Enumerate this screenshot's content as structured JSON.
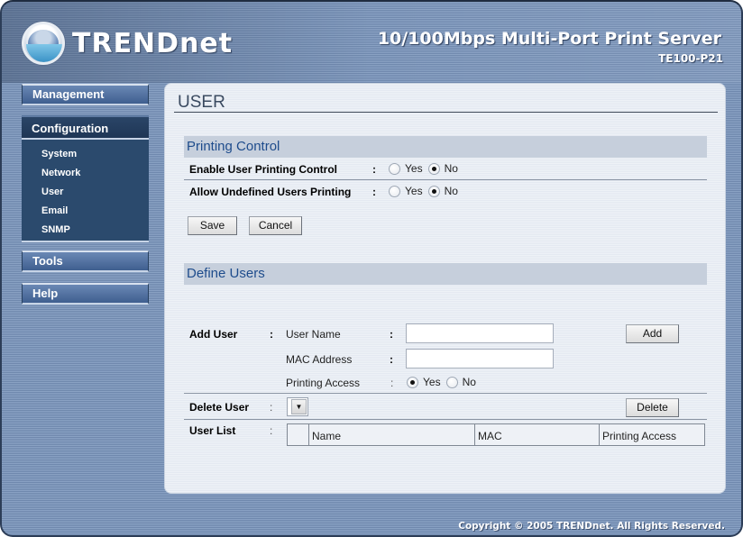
{
  "header": {
    "brand": "TRENDnet",
    "product_title": "10/100Mbps Multi-Port Print Server",
    "model": "TE100-P21"
  },
  "sidebar": {
    "management": "Management",
    "configuration": "Configuration",
    "configuration_items": [
      "System",
      "Network",
      "User",
      "Email",
      "SNMP"
    ],
    "tools": "Tools",
    "help": "Help",
    "active_item": "User"
  },
  "page": {
    "title": "USER",
    "printing_control": {
      "heading": "Printing Control",
      "enable_label": "Enable User Printing Control",
      "allow_label": "Allow Undefined Users Printing",
      "colon": ":",
      "yes": "Yes",
      "no": "No",
      "enable_value": "No",
      "allow_value": "No",
      "save": "Save",
      "cancel": "Cancel"
    },
    "define_users": {
      "heading": "Define Users",
      "add_user_label": "Add User",
      "user_name_label": "User Name",
      "mac_label": "MAC Address",
      "access_label": "Printing Access",
      "user_name_value": "",
      "mac_value": "",
      "access_value": "Yes",
      "yes": "Yes",
      "no": "No",
      "add": "Add",
      "delete_user_label": "Delete User",
      "delete_select_value": "",
      "delete": "Delete",
      "user_list_label": "User List",
      "colon": ":",
      "table_columns": [
        "",
        "Name",
        "MAC",
        "Printing Access"
      ]
    }
  },
  "footer": {
    "copyright": "Copyright © 2005 TRENDnet. All Rights Reserved."
  }
}
